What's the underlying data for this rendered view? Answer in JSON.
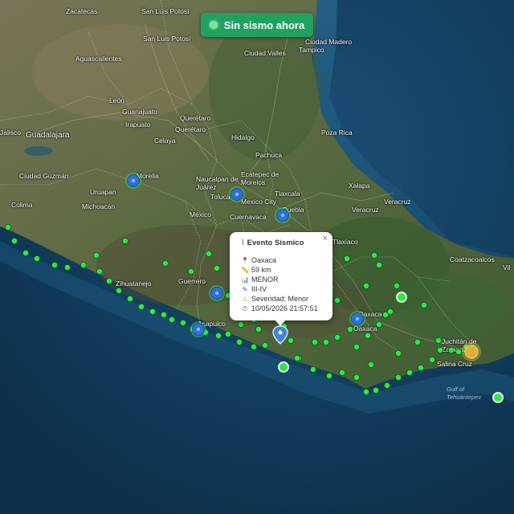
{
  "status": {
    "label": "Sin sismo ahora",
    "indicator_color": "#7fe29b",
    "pill_color": "#21a161"
  },
  "popup": {
    "title": "Evento Sísmico",
    "close": "×",
    "location": "Oaxaca",
    "depth": "59 km",
    "magnitude_class": "MENOR",
    "intensity": "III-IV",
    "severity": "Severidad: Menor",
    "datetime": "10/05/2026 21:57:51",
    "icons": {
      "title": "seismograph-icon",
      "location": "pin-icon",
      "depth": "ruler-icon",
      "magnitude": "chart-icon",
      "intensity": "pen-icon",
      "severity": "warning-icon",
      "datetime": "clock-icon"
    }
  },
  "colors": {
    "sea": "#0f3a5a",
    "land": "#4e5c3a",
    "station": "#2ee84a",
    "cluster": "#2f6fd6",
    "alert": "#d9b23a"
  },
  "labels": {
    "zacatecas": "Zacatecas",
    "potosi": "San Luis Potosí",
    "sanluis": "San Luis Potosí",
    "aguascalientes": "Aguascalientes",
    "leon": "León",
    "guanajuato": "Guanajuato",
    "irapuato": "Irapuato",
    "queretaro": "Querétaro",
    "queretaro2": "Querétaro",
    "celaya": "Celaya",
    "guadalajara": "Guadalajara",
    "jalisco": "Jalisco",
    "ciudad_guzman": "Ciudad Guzmán",
    "colima": "Colima",
    "uruapan": "Uruapan",
    "michoacan": "Michoacán",
    "morelia": "Morelia",
    "naucalpan": "Naucalpan de Juárez",
    "toluca": "Toluca",
    "mexico_city": "Mexico City",
    "mexico": "México",
    "cuernavaca": "Cuernavaca",
    "ecatepec": "Ecatepec de Morelos",
    "tlaxcala": "Tlaxcala",
    "puebla": "Puebla",
    "hidalgo": "Hidalgo",
    "pachuca": "Pachuca",
    "ciudad_valles": "Ciudad Valles",
    "ciudad_madero": "Ciudad Madero",
    "tampico": "Tampico",
    "poza_rica": "Poza Rica",
    "xalapa": "Xalapa",
    "veracruz": "Veracruz",
    "veracruz2": "Veracruz",
    "coatzacoalcos": "Coatzacoalcos",
    "villa": "Vil",
    "guerrero": "Guerrero",
    "acapulco": "Acapulco",
    "zihuatanejo": "Zihuatanejo",
    "oaxaca_city": "Oaxaca",
    "oaxaca_state": "Oaxaca",
    "juchitan": "Juchitán de Zaragoza",
    "salina_cruz": "Salina Cruz",
    "gulf": "Gulf of Tehuantepec",
    "tlaxiaco": "Tlaxiaco"
  }
}
